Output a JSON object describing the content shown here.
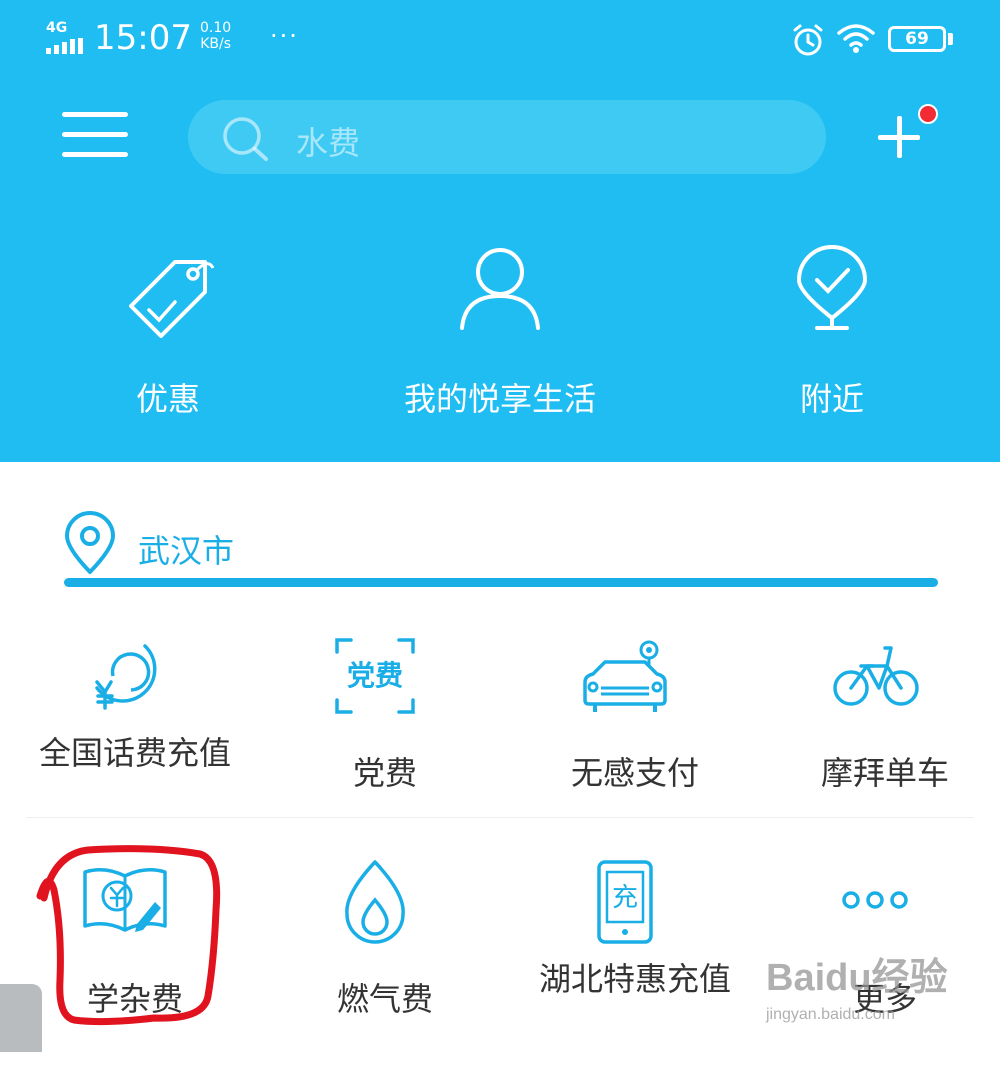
{
  "status_bar": {
    "network": "4G",
    "time": "15:07",
    "speed_value": "0.10",
    "speed_unit": "KB/s",
    "more": "···",
    "battery": "69",
    "icons": [
      "signal-icon",
      "alarm-icon",
      "wifi-icon",
      "battery-icon"
    ]
  },
  "header": {
    "search_text": "水费",
    "notification_dot_color": "#f22b35",
    "background_color": "#1fbdf2"
  },
  "quick_actions": [
    {
      "label": "优惠",
      "icon": "tag-icon"
    },
    {
      "label": "我的悦享生活",
      "icon": "user-icon"
    },
    {
      "label": "附近",
      "icon": "location-check-icon"
    }
  ],
  "city": {
    "name": "武汉市",
    "accent_color": "#1aaee6"
  },
  "services_row1": [
    {
      "label": "全国话费充值",
      "icon": "phone-recharge-icon"
    },
    {
      "label": "党费",
      "icon": "party-fee-icon",
      "icon_text": "党费"
    },
    {
      "label": "无感支付",
      "icon": "car-pay-icon"
    },
    {
      "label": "摩拜单车",
      "icon": "bike-icon"
    }
  ],
  "services_row2": [
    {
      "label": "学杂费",
      "icon": "tuition-book-icon"
    },
    {
      "label": "燃气费",
      "icon": "gas-flame-icon"
    },
    {
      "label": "湖北特惠充值",
      "icon": "recharge-card-icon",
      "icon_text": "充"
    },
    {
      "label": "更多",
      "icon": "more-dots-icon"
    }
  ],
  "watermark": {
    "main": "Baidu经验",
    "sub": "jingyan.baidu.com"
  }
}
